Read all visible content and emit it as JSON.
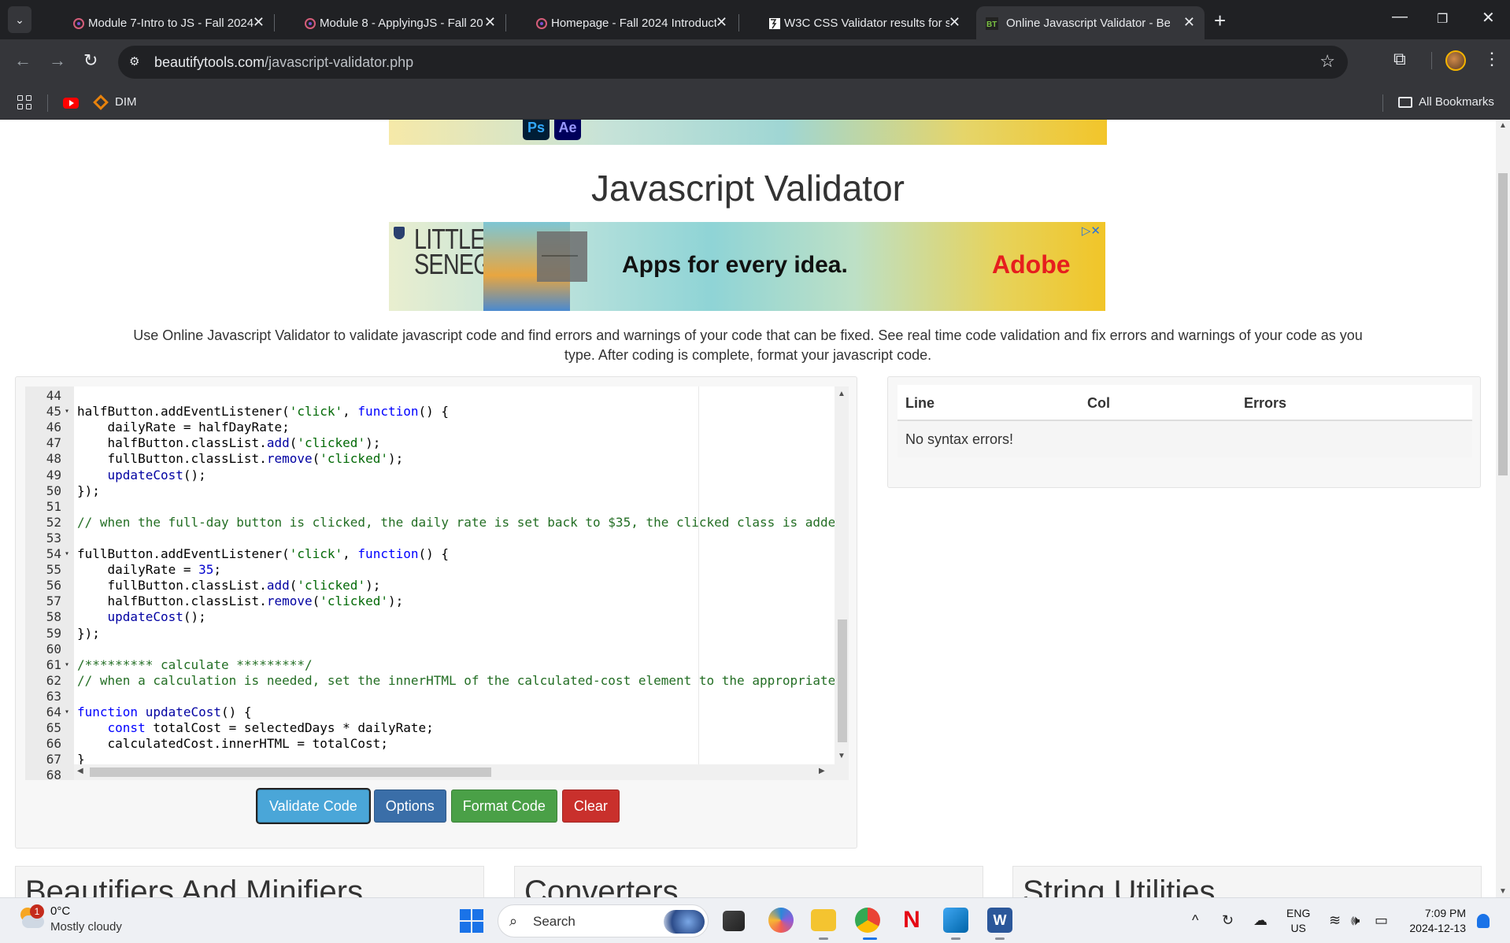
{
  "tabs": [
    {
      "label": "Module 7-Intro to JS - Fall 2024",
      "active": false
    },
    {
      "label": "Module 8 - ApplyingJS - Fall 20",
      "active": false
    },
    {
      "label": "Homepage - Fall 2024 Introduct",
      "active": false
    },
    {
      "label": "W3C CSS Validator results for st",
      "active": false
    },
    {
      "label": "Online Javascript Validator - Be",
      "active": true
    }
  ],
  "address_bar": {
    "host": "beautifytools.com",
    "path": "/javascript-validator.php"
  },
  "bookmarks": {
    "items": [
      {
        "label": "DIM"
      }
    ],
    "all_label": "All Bookmarks"
  },
  "page": {
    "ad_top": {
      "ps": "Ps",
      "ae": "Ae"
    },
    "title": "Javascript Validator",
    "ad": {
      "brand_text": "LITTLE\nSENEGAL",
      "tagline": "Apps for every idea.",
      "logo": "Adobe"
    },
    "description": "Use Online Javascript Validator to validate javascript code and find errors and warnings of your code that can be fixed. See real time code validation and fix errors and warnings of your code as you type. After coding is complete, format your javascript code."
  },
  "editor": {
    "lines": [
      {
        "n": "44",
        "fold": false,
        "text": ""
      },
      {
        "n": "45",
        "fold": true,
        "text": "halfButton.addEventListener('click', function() {"
      },
      {
        "n": "46",
        "fold": false,
        "text": "    dailyRate = halfDayRate;"
      },
      {
        "n": "47",
        "fold": false,
        "text": "    halfButton.classList.add('clicked');"
      },
      {
        "n": "48",
        "fold": false,
        "text": "    fullButton.classList.remove('clicked');"
      },
      {
        "n": "49",
        "fold": false,
        "text": "    updateCost();"
      },
      {
        "n": "50",
        "fold": false,
        "text": "});"
      },
      {
        "n": "51",
        "fold": false,
        "text": ""
      },
      {
        "n": "52",
        "fold": false,
        "text": "// when the full-day button is clicked, the daily rate is set back to $35, the clicked class is adde"
      },
      {
        "n": "53",
        "fold": false,
        "text": ""
      },
      {
        "n": "54",
        "fold": true,
        "text": "fullButton.addEventListener('click', function() {"
      },
      {
        "n": "55",
        "fold": false,
        "text": "    dailyRate = 35;"
      },
      {
        "n": "56",
        "fold": false,
        "text": "    fullButton.classList.add('clicked');"
      },
      {
        "n": "57",
        "fold": false,
        "text": "    halfButton.classList.remove('clicked');"
      },
      {
        "n": "58",
        "fold": false,
        "text": "    updateCost();"
      },
      {
        "n": "59",
        "fold": false,
        "text": "});"
      },
      {
        "n": "60",
        "fold": false,
        "text": ""
      },
      {
        "n": "61",
        "fold": true,
        "text": "/********* calculate *********/"
      },
      {
        "n": "62",
        "fold": false,
        "text": "// when a calculation is needed, set the innerHTML of the calculated-cost element to the appropriate"
      },
      {
        "n": "63",
        "fold": false,
        "text": ""
      },
      {
        "n": "64",
        "fold": true,
        "text": "function updateCost() {"
      },
      {
        "n": "65",
        "fold": false,
        "text": "    const totalCost = selectedDays * dailyRate;"
      },
      {
        "n": "66",
        "fold": false,
        "text": "    calculatedCost.innerHTML = totalCost;"
      },
      {
        "n": "67",
        "fold": false,
        "text": "}"
      },
      {
        "n": "68",
        "fold": false,
        "text": ""
      }
    ]
  },
  "buttons": {
    "validate": "Validate Code",
    "options": "Options",
    "format": "Format Code",
    "clear": "Clear"
  },
  "results": {
    "headers": {
      "line": "Line",
      "col": "Col",
      "errors": "Errors"
    },
    "message": "No syntax errors!"
  },
  "bottom_cards": [
    "Beautifiers And Minifiers",
    "Converters",
    "String Utilities"
  ],
  "taskbar": {
    "weather": {
      "temp": "0°C",
      "condition": "Mostly cloudy",
      "badge": "1"
    },
    "search_placeholder": "Search",
    "lang": {
      "line1": "ENG",
      "line2": "US"
    },
    "clock": {
      "time": "7:09 PM",
      "date": "2024-12-13"
    }
  },
  "colors": {
    "validate": "#4aa6d8",
    "options": "#3a6ea8",
    "format": "#4aa047",
    "clear": "#c9302c"
  }
}
